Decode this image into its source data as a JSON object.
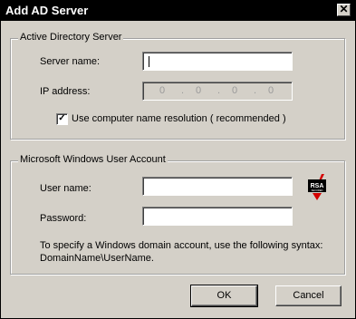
{
  "window": {
    "title": "Add AD Server",
    "close_glyph": "✕"
  },
  "ad_group": {
    "legend": "Active Directory Server",
    "server_name_label": "Server name:",
    "server_name_value": "",
    "ip_label": "IP address:",
    "ip_octets": [
      "0",
      "0",
      "0",
      "0"
    ],
    "use_name_resolution_label": "Use computer name resolution ( recommended )",
    "use_name_resolution_checked": true
  },
  "account_group": {
    "legend": "Microsoft Windows User Account",
    "user_name_label": "User name:",
    "user_name_value": "",
    "password_label": "Password:",
    "password_value": "",
    "hint_line1": "To specify a Windows domain account, use the following syntax:",
    "hint_line2": "DomainName\\UserName.",
    "badge_text": "RSA",
    "badge_subtext": "SECURED",
    "badge_icon": "rsa-secured-icon"
  },
  "buttons": {
    "ok": "OK",
    "cancel": "Cancel"
  },
  "colors": {
    "face": "#d4d0c8",
    "titlebar": "#000000",
    "badge_red": "#d40000"
  }
}
